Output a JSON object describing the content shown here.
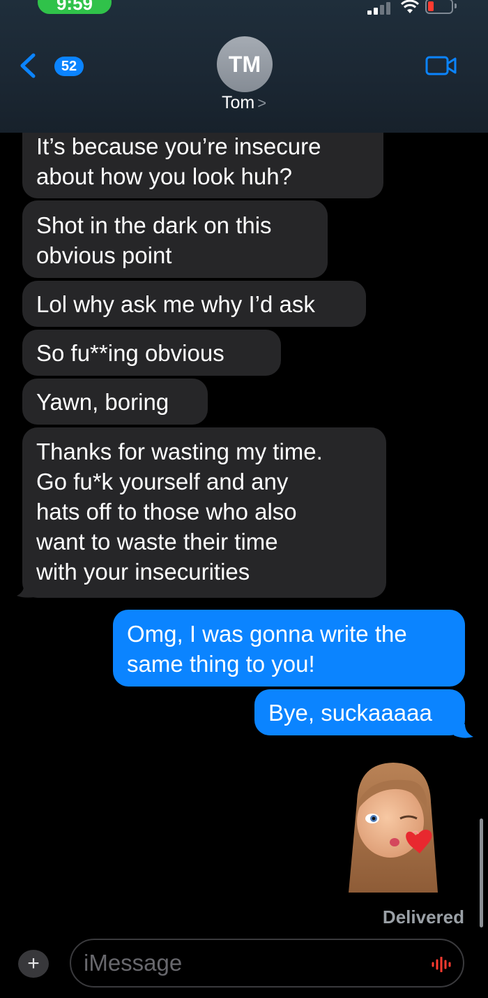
{
  "status_bar": {
    "time": "9:59"
  },
  "header": {
    "unread_count": "52",
    "avatar_initials": "TM",
    "contact_name": "Tom",
    "contact_arrow": ">"
  },
  "messages": [
    {
      "direction": "incoming",
      "text": "It’s because you’re insecure\nabout how you look huh?"
    },
    {
      "direction": "incoming",
      "text": "Shot in the dark on this\nobvious point"
    },
    {
      "direction": "incoming",
      "text": "Lol why ask me why I’d ask"
    },
    {
      "direction": "incoming",
      "text": "So fu**ing obvious"
    },
    {
      "direction": "incoming",
      "text": "Yawn, boring"
    },
    {
      "direction": "incoming",
      "text": "Thanks for wasting my time.\nGo fu*k yourself and any\nhats off to those who also\nwant to waste their time\nwith your insecurities"
    },
    {
      "direction": "outgoing",
      "text": "Omg, I was gonna write the\nsame thing to you!"
    },
    {
      "direction": "outgoing",
      "text": "Bye, suckaaaaa"
    }
  ],
  "sticker": {
    "icon": "kissing-memoji-sticker"
  },
  "delivery_status": "Delivered",
  "composer": {
    "placeholder": "iMessage",
    "plus_label": "+"
  },
  "colors": {
    "incoming_bubble": "#262628",
    "outgoing_bubble": "#0b84ff",
    "header": "#1b2733",
    "status_time_pill": "#30c24a"
  }
}
